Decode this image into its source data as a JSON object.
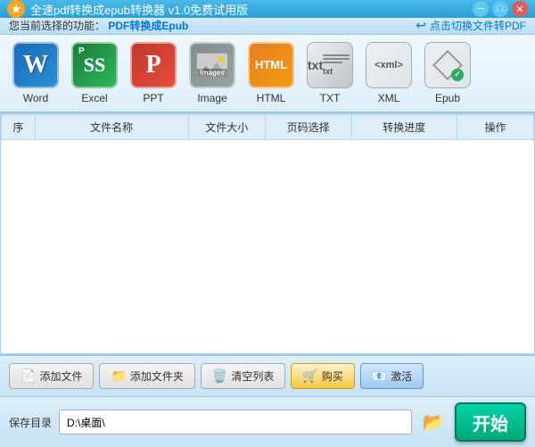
{
  "titleBar": {
    "title": "全速pdf转换成epub转换器 v1.0免费试用版",
    "logoText": "★",
    "minBtn": "─",
    "maxBtn": "□",
    "closeBtn": "✕"
  },
  "toolbar": {
    "label": "您当前选择的功能：",
    "function": "PDF转换成Epub",
    "switchText": "点击切换文件转PDF"
  },
  "icons": [
    {
      "id": "word",
      "label": "Word"
    },
    {
      "id": "excel",
      "label": "Excel"
    },
    {
      "id": "ppt",
      "label": "PPT"
    },
    {
      "id": "image",
      "label": "Image"
    },
    {
      "id": "html",
      "label": "HTML"
    },
    {
      "id": "txt",
      "label": "TXT"
    },
    {
      "id": "xml",
      "label": "XML"
    },
    {
      "id": "epub",
      "label": "Epub"
    }
  ],
  "table": {
    "columns": [
      "序",
      "文件名称",
      "文件大小",
      "页码选择",
      "转换进度",
      "操作"
    ]
  },
  "buttons": {
    "addFile": "添加文件",
    "addFolder": "添加文件夹",
    "clearList": "清空列表",
    "buy": "购买",
    "activate": "激活"
  },
  "saveBar": {
    "label": "保存目录",
    "path": "D:\\桌面\\",
    "startBtn": "开始"
  }
}
